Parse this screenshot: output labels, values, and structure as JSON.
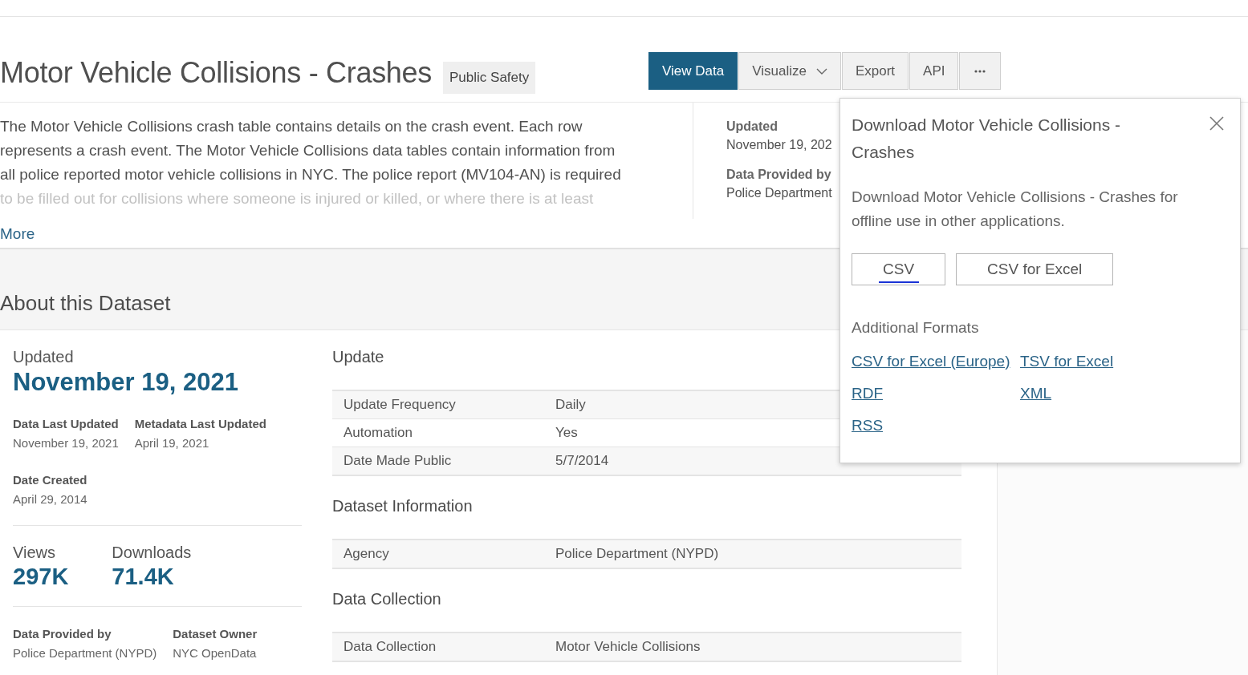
{
  "header": {
    "title": "Motor Vehicle Collisions - Crashes",
    "category": "Public Safety"
  },
  "actions": [
    {
      "label": "View Data",
      "kind": "button",
      "selected": true
    },
    {
      "label": "Visualize",
      "kind": "dropdown",
      "selected": false
    },
    {
      "label": "Export",
      "kind": "button",
      "selected": false
    },
    {
      "label": "API",
      "kind": "button",
      "selected": false
    },
    {
      "kind": "more",
      "selected": false
    }
  ],
  "description": {
    "lines": [
      "The Motor Vehicle Collisions crash table contains details on the crash event. Each row",
      "represents a crash event. The Motor Vehicle Collisions data tables contain information from",
      "all police reported motor vehicle collisions in NYC. The police report (MV104-AN) is required",
      "to be filled out for collisions where someone is injured or killed, or where there is at least"
    ],
    "more_link": "More"
  },
  "summary": [
    {
      "label": "Updated",
      "value": "November 19, 202"
    },
    {
      "label": "Data Provided by",
      "value": "Police Department"
    }
  ],
  "about": {
    "title": "About this Dataset",
    "updated_label": "Updated",
    "updated_value": "November 19, 2021",
    "dates": [
      {
        "label": "Data Last Updated",
        "value": "November 19, 2021"
      },
      {
        "label": "Metadata Last Updated",
        "value": "April 19, 2021"
      }
    ],
    "created": {
      "label": "Date Created",
      "value": "April 29, 2014"
    },
    "stats": [
      {
        "label": "Views",
        "value": "297K"
      },
      {
        "label": "Downloads",
        "value": "71.4K"
      }
    ],
    "provenance": [
      {
        "label": "Data Provided by",
        "value": "Police Department (NYPD)"
      },
      {
        "label": "Dataset Owner",
        "value": "NYC OpenData"
      }
    ]
  },
  "sections": [
    {
      "title": "Update",
      "rows": [
        {
          "label": "Update Frequency",
          "value": "Daily"
        },
        {
          "label": "Automation",
          "value": "Yes"
        },
        {
          "label": "Date Made Public",
          "value": "5/7/2014"
        }
      ]
    },
    {
      "title": "Dataset Information",
      "rows": [
        {
          "label": "Agency",
          "value": "Police Department (NYPD)"
        }
      ]
    },
    {
      "title": "Data Collection",
      "rows": [
        {
          "label": "Data Collection",
          "value": "Motor Vehicle Collisions"
        }
      ]
    }
  ],
  "download_dialog": {
    "title": "Download Motor Vehicle Collisions - Crashes",
    "text": "Download Motor Vehicle Collisions - Crashes for offline use in other applications.",
    "buttons": [
      {
        "label": "CSV",
        "focused": true
      },
      {
        "label": "CSV for Excel",
        "focused": false
      }
    ],
    "additional_title": "Additional Formats",
    "formats": [
      "CSV for Excel (Europe)",
      "TSV for Excel",
      "RDF",
      "XML",
      "RSS"
    ]
  }
}
